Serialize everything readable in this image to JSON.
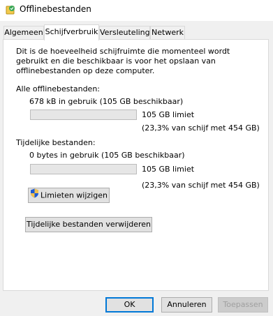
{
  "window": {
    "title": "Offlinebestanden"
  },
  "tabs": [
    {
      "label": "Algemeen",
      "active": false
    },
    {
      "label": "Schijfverbruik",
      "active": true
    },
    {
      "label": "Versleuteling",
      "active": false
    },
    {
      "label": "Netwerk",
      "active": false
    }
  ],
  "description": "Dit is de hoeveelheid schijfruimte die momenteel wordt gebruikt en die beschikbaar is voor het opslaan van offlinebestanden op deze computer.",
  "all_files": {
    "heading": "Alle offlinebestanden:",
    "usage": "678 kB in gebruik (105 GB beschikbaar)",
    "usage_fraction": 0.0,
    "limit": "105 GB limiet",
    "limit_pct": "(23,3% van schijf met 454 GB)"
  },
  "temp_files": {
    "heading": "Tijdelijke bestanden:",
    "usage": "0 bytes in gebruik (105 GB beschikbaar)",
    "usage_fraction": 0.0,
    "limit": "105 GB limiet",
    "limit_pct": "(23,3% van schijf met 454 GB)"
  },
  "buttons": {
    "change_limits": "Limieten wijzigen",
    "delete_temp": "Tijdelijke bestanden verwijderen",
    "ok": "OK",
    "cancel": "Annuleren",
    "apply": "Toepassen"
  },
  "colors": {
    "accent": "#0078d7",
    "progress": "#06b025"
  }
}
